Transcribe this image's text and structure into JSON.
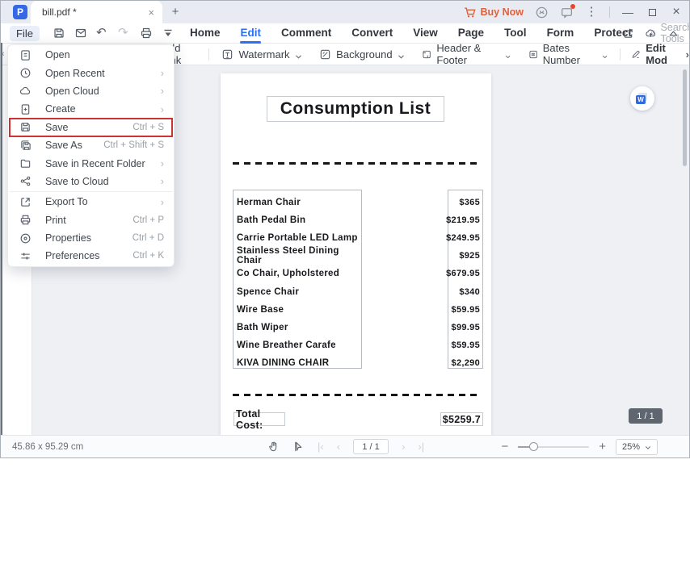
{
  "titlebar": {
    "tab_title": "bill.pdf *",
    "close_tab": "×",
    "new_tab": "+",
    "buy_now": "Buy Now",
    "minimize": "—",
    "close_window": "×"
  },
  "menubar": {
    "file": "File",
    "items": [
      "Home",
      "Edit",
      "Comment",
      "Convert",
      "View",
      "Page",
      "Tool",
      "Form",
      "Protect"
    ],
    "active_item": "Edit",
    "search_placeholder": "Search Tools"
  },
  "ribbon": {
    "add_link": "Add Link",
    "watermark": "Watermark",
    "background": "Background",
    "header_footer": "Header & Footer",
    "bates_number": "Bates Number",
    "edit_mode": "Edit Mod"
  },
  "file_menu": {
    "items": [
      {
        "label": "Open",
        "icon": "doclines",
        "shortcut": "",
        "submenu": false,
        "highlighted": false,
        "divider_after": false
      },
      {
        "label": "Open Recent",
        "icon": "clock",
        "shortcut": "",
        "submenu": true,
        "highlighted": false,
        "divider_after": false
      },
      {
        "label": "Open Cloud",
        "icon": "cloud",
        "shortcut": "",
        "submenu": true,
        "highlighted": false,
        "divider_after": false
      },
      {
        "label": "Create",
        "icon": "fileplus",
        "shortcut": "",
        "submenu": true,
        "highlighted": false,
        "divider_after": false
      },
      {
        "label": "Save",
        "icon": "floppy",
        "shortcut": "Ctrl + S",
        "submenu": false,
        "highlighted": true,
        "divider_after": false
      },
      {
        "label": "Save As",
        "icon": "floppy2",
        "shortcut": "Ctrl + Shift + S",
        "submenu": false,
        "highlighted": false,
        "divider_after": false
      },
      {
        "label": "Save in Recent Folder",
        "icon": "folder",
        "shortcut": "",
        "submenu": true,
        "highlighted": false,
        "divider_after": false
      },
      {
        "label": "Save to Cloud",
        "icon": "sharenodes",
        "shortcut": "",
        "submenu": true,
        "highlighted": false,
        "divider_after": true
      },
      {
        "label": "Export To",
        "icon": "export",
        "shortcut": "",
        "submenu": true,
        "highlighted": false,
        "divider_after": false
      },
      {
        "label": "Print",
        "icon": "printer",
        "shortcut": "Ctrl + P",
        "submenu": false,
        "highlighted": false,
        "divider_after": false
      },
      {
        "label": "Properties",
        "icon": "circledot",
        "shortcut": "Ctrl + D",
        "submenu": false,
        "highlighted": false,
        "divider_after": false
      },
      {
        "label": "Preferences",
        "icon": "sliders",
        "shortcut": "Ctrl + K",
        "submenu": false,
        "highlighted": false,
        "divider_after": false
      }
    ]
  },
  "document": {
    "title": "Consumption List",
    "items": [
      {
        "name": "Herman Chair",
        "price": "$365"
      },
      {
        "name": "Bath Pedal Bin",
        "price": "$219.95"
      },
      {
        "name": "Carrie Portable LED Lamp",
        "price": "$249.95"
      },
      {
        "name": "Stainless Steel Dining Chair",
        "price": "$925"
      },
      {
        "name": "Co Chair, Upholstered",
        "price": "$679.95"
      },
      {
        "name": "Spence Chair",
        "price": "$340"
      },
      {
        "name": "Wire Base",
        "price": "$59.95"
      },
      {
        "name": "Bath Wiper",
        "price": "$99.95"
      },
      {
        "name": "Wine Breather Carafe",
        "price": "$59.95"
      },
      {
        "name": "KIVA DINING CHAIR",
        "price": "$2,290"
      }
    ],
    "total_label": "Total Cost:",
    "total_value": "$5259.7"
  },
  "viewer": {
    "page_badge": "1 / 1",
    "word_fab_letter": "W"
  },
  "statusbar": {
    "dimensions": "45.86 x 95.29 cm",
    "page_indicator": "1 / 1",
    "zoom_level": "25%"
  },
  "colors": {
    "accent_blue": "#2b6ff2",
    "buy_now_orange": "#e0603a",
    "highlight_red": "#cc3434",
    "titlebar_bg": "#e8ecf2",
    "canvas_bg": "#eef0f4"
  }
}
